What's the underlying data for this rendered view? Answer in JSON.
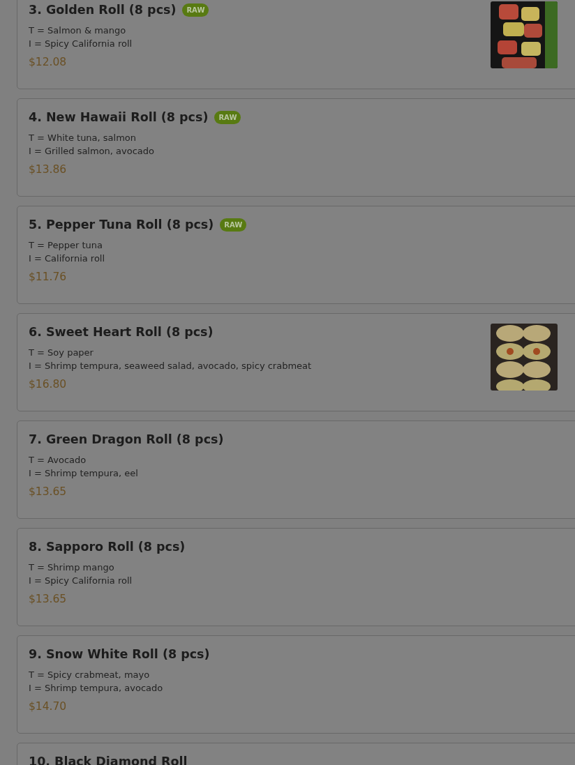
{
  "menu_items": [
    {
      "title": "3. Golden Roll (8 pcs)",
      "badge": "RAW",
      "lines": [
        "T = Salmon & mango",
        "I = Spicy California roll"
      ],
      "price": "$12.08"
    },
    {
      "title": "4. New Hawaii Roll (8 pcs)",
      "badge": "RAW",
      "lines": [
        "T = White tuna, salmon",
        "I = Grilled salmon, avocado"
      ],
      "price": "$13.86"
    },
    {
      "title": "5. Pepper Tuna Roll (8 pcs)",
      "badge": "RAW",
      "lines": [
        "T = Pepper tuna",
        "I = California roll"
      ],
      "price": "$11.76"
    },
    {
      "title": "6. Sweet Heart Roll (8 pcs)",
      "lines": [
        "T = Soy paper",
        "I = Shrimp tempura, seaweed salad, avocado, spicy crabmeat"
      ],
      "price": "$16.80"
    },
    {
      "title": "7. Green Dragon Roll (8 pcs)",
      "lines": [
        "T = Avocado",
        "I = Shrimp tempura, eel"
      ],
      "price": "$13.65"
    },
    {
      "title": "8. Sapporo Roll (8 pcs)",
      "lines": [
        "T = Shrimp mango",
        "I = Spicy California roll"
      ],
      "price": "$13.65"
    },
    {
      "title": "9. Snow White Roll (8 pcs)",
      "lines": [
        "T = Spicy crabmeat, mayo",
        "I = Shrimp tempura, avocado"
      ],
      "price": "$14.70"
    },
    {
      "title": "10. Black Diamond Roll"
    }
  ]
}
